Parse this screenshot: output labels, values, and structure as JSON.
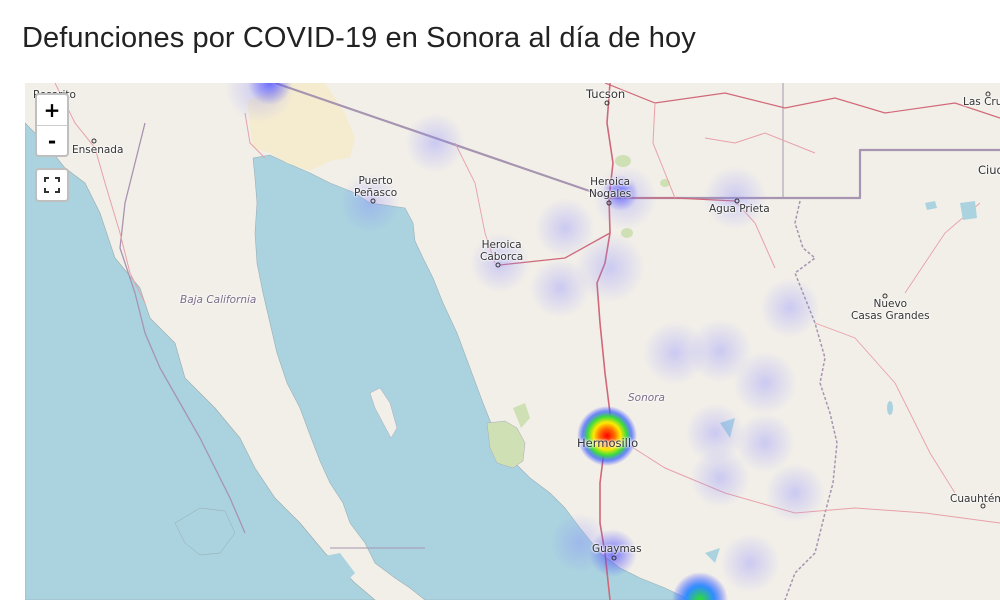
{
  "page": {
    "title": "Defunciones por COVID-19 en Sonora al día de hoy"
  },
  "controls": {
    "zoom_in": "+",
    "zoom_out": "-",
    "fullscreen_icon": "fullscreen-icon"
  },
  "map": {
    "region_labels": {
      "baja_california": "Baja California",
      "sonora": "Sonora"
    },
    "city_labels": {
      "rosarito": "Rosarito",
      "ensenada": "Ensenada",
      "tucson": "Tucson",
      "las_cruces": "Las Cruc",
      "ciudad": "Ciud",
      "puerto_penasco_1": "Puerto",
      "puerto_penasco_2": "Peñasco",
      "heroica_nogales_1": "Heroica",
      "heroica_nogales_2": "Nogales",
      "agua_prieta": "Agua Prieta",
      "heroica_caborca_1": "Heroica",
      "heroica_caborca_2": "Caborca",
      "nuevo_casas_grandes_1": "Nuevo",
      "nuevo_casas_grandes_2": "Casas Grandes",
      "hermosillo": "Hermosillo",
      "guaymas": "Guaymas",
      "cuauhtemoc": "Cuauhtém"
    },
    "colors": {
      "land": "#f2efe9",
      "water": "#aad3df",
      "park": "#cfe0b4",
      "border": "#a694b0",
      "road": "#e8a0a8",
      "highway": "#d06878"
    },
    "heatmap": "Defunciones por COVID-19"
  }
}
